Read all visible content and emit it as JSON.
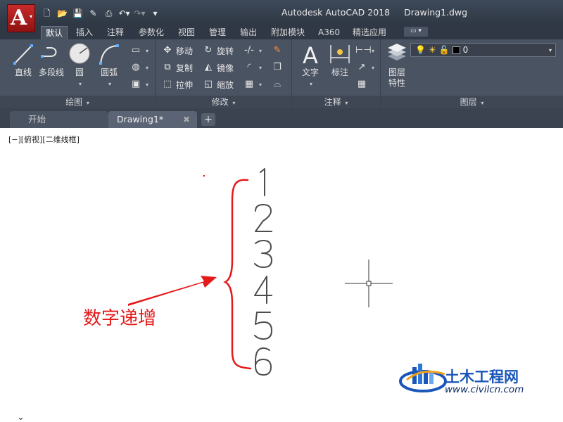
{
  "app": {
    "logo_letter": "A",
    "title": "Autodesk AutoCAD 2018",
    "document": "Drawing1.dwg"
  },
  "ribbon_tabs": [
    "默认",
    "插入",
    "注释",
    "参数化",
    "视图",
    "管理",
    "输出",
    "附加模块",
    "A360",
    "精选应用"
  ],
  "panels": {
    "draw": {
      "title": "绘图",
      "tools": [
        "直线",
        "多段线",
        "圆",
        "圆弧"
      ]
    },
    "modify": {
      "title": "修改",
      "tools": [
        "移动",
        "旋转",
        "复制",
        "镜像",
        "拉伸",
        "缩放"
      ]
    },
    "annotation": {
      "title": "注释",
      "tools": [
        "文字",
        "标注"
      ]
    },
    "layers": {
      "title": "图层",
      "properties_label": [
        "图层",
        "特性"
      ],
      "current_layer": "0"
    }
  },
  "file_tabs": {
    "start": "开始",
    "drawing": "Drawing1*",
    "add": "+"
  },
  "viewport": {
    "label": "[−][俯视][二维线框]"
  },
  "drawing": {
    "numbers": [
      "1",
      "2",
      "3",
      "4",
      "5",
      "6"
    ]
  },
  "annotation_text": "数字递增",
  "watermark": {
    "name": "土木工程网",
    "url": "www.civilcn.com"
  },
  "colors": {
    "ribbon": "#4a5362",
    "titlebar": "#2f3844",
    "annotation_red": "#e31b1b",
    "watermark_blue": "#1a56b8"
  }
}
